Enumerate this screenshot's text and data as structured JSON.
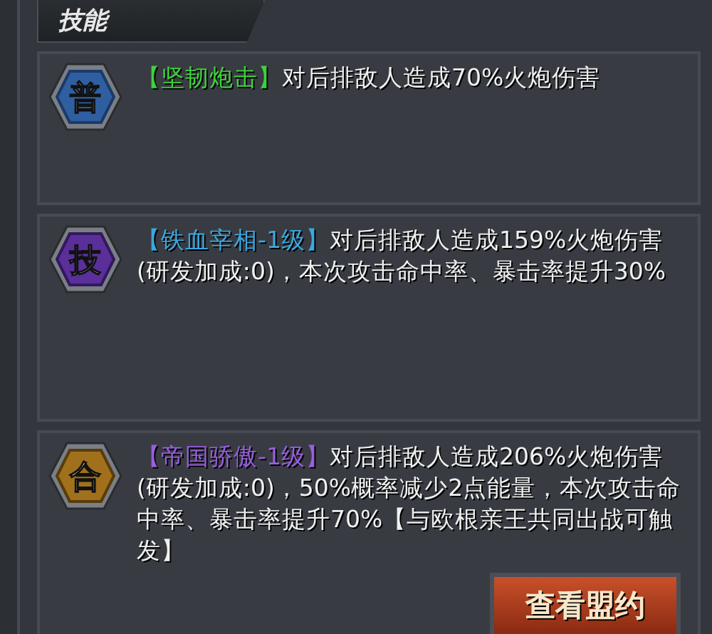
{
  "header": {
    "title": "技能"
  },
  "skills": [
    {
      "kind": "normal",
      "badge": "普",
      "name": "【坚韧炮击】",
      "color": "#3ed23e",
      "description": "对后排敌人造成70%火炮伤害"
    },
    {
      "kind": "skill",
      "badge": "技",
      "name": "【铁血宰相-1级】",
      "color": "#3aa8e0",
      "description": "对后排敌人造成159%火炮伤害(研发加成:0)，本次攻击命中率、暴击率提升30%"
    },
    {
      "kind": "combo",
      "badge": "合",
      "name": "【帝国骄傲-1级】",
      "color": "#9a5ee0",
      "description": "对后排敌人造成206%火炮伤害(研发加成:0)，50%概率减少2点能量，本次攻击命中率、暴击率提升70%【与欧根亲王共同出战可触发】"
    }
  ],
  "button": {
    "label": "查看盟约"
  }
}
